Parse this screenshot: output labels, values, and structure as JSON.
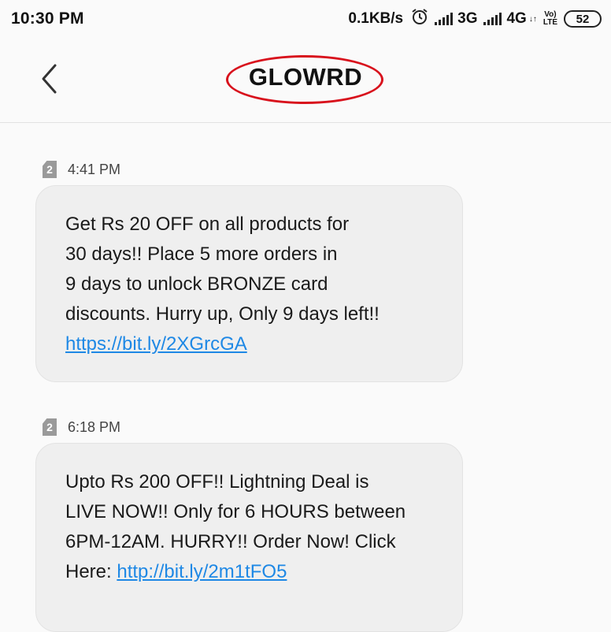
{
  "status_bar": {
    "time": "10:30 PM",
    "net_speed": "0.1KB/s",
    "network_1": "3G",
    "network_2": "4G",
    "volte_top": "Vo)",
    "volte_bottom": "LTE",
    "battery": "52"
  },
  "header": {
    "title": "GLOWRD",
    "annotation_color": "#d8111c"
  },
  "messages": [
    {
      "sim": "2",
      "time": "4:41 PM",
      "lines": [
        "Get Rs 20 OFF on all products for",
        "30 days!! Place 5 more orders in",
        "9 days to unlock BRONZE card",
        "discounts. Hurry up, Only 9 days left!!"
      ],
      "link": "https://bit.ly/2XGrcGA"
    },
    {
      "sim": "2",
      "time": "6:18 PM",
      "lines": [
        "Upto Rs 200 OFF!! Lightning Deal is",
        "LIVE NOW!! Only for 6 HOURS between",
        "6PM-12AM. HURRY!!  Order Now! Click"
      ],
      "link_prefix": "Here: ",
      "link": "http://bit.ly/2m1tFO5"
    }
  ],
  "icons": [
    "back-arrow-icon",
    "alarm-icon",
    "signal-icon",
    "battery-icon",
    "sim-icon"
  ],
  "colors": {
    "link": "#1e88e5",
    "bubble": "#efefef",
    "background": "#fafafa"
  }
}
